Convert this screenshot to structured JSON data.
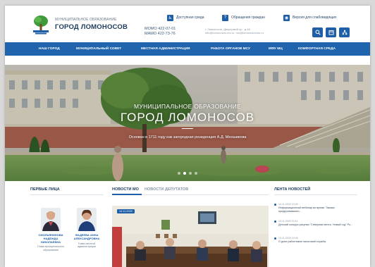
{
  "header": {
    "logo_sub": "МУНИЦИПАЛЬНОЕ ОБРАЗОВАНИЕ",
    "logo_title": "ГОРОД ЛОМОНОСОВ",
    "phones": [
      "МОМО 422-07-01",
      "МАМО 422-73-76"
    ],
    "address": [
      "г. Ломоносов, Дворцовый пр., д.48",
      "info@lomonosov-mo.ru, mo@lomonosovmo.ru"
    ],
    "top_links": [
      {
        "label": "Доступная среда",
        "icon": "accessibility-icon"
      },
      {
        "label": "Обращения граждан",
        "icon": "question-icon"
      },
      {
        "label": "Версия для слабовидящих",
        "icon": "eye-icon"
      }
    ],
    "buttons": [
      "search-icon",
      "calendar-icon",
      "sitemap-icon"
    ]
  },
  "nav": {
    "items": [
      "НАШ ГОРОД",
      "МУНИЦИПАЛЬНЫЙ СОВЕТ",
      "МЕСТНАЯ АДМИНИСТРАЦИЯ",
      "РАБОТА ОРГАНОВ МСУ",
      "МФУ МЦ",
      "КОМФОРТНАЯ СРЕДА"
    ]
  },
  "hero": {
    "subtitle": "МУНИЦИПАЛЬНОЕ ОБРАЗОВАНИЕ",
    "title": "ГОРОД ЛОМОНОСОВ",
    "caption": "Основан в 1711 году как загородная резиденция А.Д. Меншикова",
    "slides": 4,
    "active_slide": 1
  },
  "leaders": {
    "title": "ПЕРВЫЕ ЛИЦА",
    "people": [
      {
        "name": "СМОЛЬЯНИНОВА Надежда Николаевна",
        "role": "Глава муниципального образования"
      },
      {
        "name": "ФАДЕЕВА Анна Александровна",
        "role": "Глава местной администрации"
      }
    ]
  },
  "news": {
    "tabs": [
      {
        "label": "НОВОСТИ МО",
        "active": true
      },
      {
        "label": "НОВОСТИ ДЕПУТАТОВ",
        "active": false
      }
    ],
    "badge": "14.11.2020"
  },
  "feed": {
    "title": "ЛЕНТА НОВОСТЕЙ",
    "items": [
      {
        "date": "14.11.2020 10:00",
        "text": "Информационный вебинар во время \"Заказа предпринимател..."
      },
      {
        "date": "13.11.2020 13:11",
        "text": "Детский конкурс рисунка \"Северная мечта. Новый год\" Ро..."
      },
      {
        "date": "13.11.2020 10:00",
        "text": "О днях работников налоговой службы"
      }
    ]
  },
  "colors": {
    "brand": "#1e5fa8",
    "nav": "#1f64ad",
    "title": "#1b3a5c"
  }
}
